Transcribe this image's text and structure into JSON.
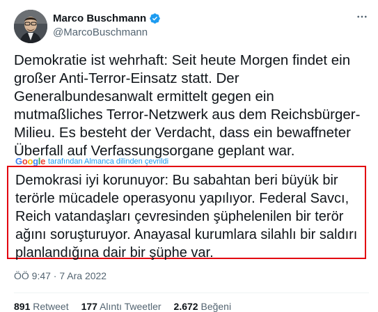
{
  "author": {
    "name": "Marco Buschmann",
    "handle": "@MarcoBuschmann",
    "verified_color": "#1d9bf0",
    "avatar_icon": "profile-photo"
  },
  "tweet": {
    "text": "Demokratie ist wehrhaft: Seit heute Morgen findet ein\ngroßer Anti-Terror-Einsatz statt. Der\nGeneralbundesanwalt ermittelt gegen ein\nmutmaßliches Terror-Netzwerk aus dem Reichsbürger-\nMilieu. Es besteht der Verdacht, dass ein bewaffneter\nÜberfall auf Verfassungsorgane geplant war."
  },
  "translation": {
    "provider": "Google",
    "note": "tarafından Almanca dilinden çevrildi",
    "text": "Demokrasi iyi korunuyor: Bu sabahtan beri büyük bir\nterörle mücadele operasyonu yapılıyor. Federal Savcı,\nReich vatandaşları çevresinden şüphelenilen bir terör\nağını soruşturuyor. Anayasal kurumlara silahlı bir saldırı\nplanlandığına dair bir şüphe var.",
    "highlight_color": "#e3000f"
  },
  "meta": {
    "timestamp": "ÖÖ 9:47 · 7 Ara 2022"
  },
  "stats": {
    "retweets_count": "891",
    "retweets_label": "Retweet",
    "quotes_count": "177",
    "quotes_label": "Alıntı Tweetler",
    "likes_count": "2.672",
    "likes_label": "Beğeni"
  }
}
